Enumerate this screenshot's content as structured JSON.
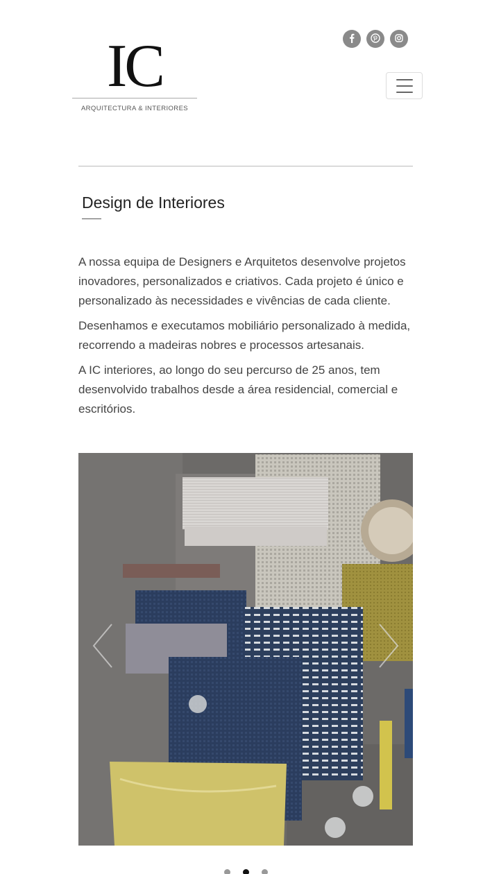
{
  "brand": {
    "logo_mark": "IC",
    "logo_sub": "ARQUITECTURA & INTERIORES"
  },
  "social": [
    {
      "name": "facebook-icon",
      "glyph": "f"
    },
    {
      "name": "pinterest-icon",
      "glyph": "p"
    },
    {
      "name": "instagram-icon",
      "glyph": "ig"
    }
  ],
  "page": {
    "title": "Design de Interiores",
    "paragraphs": [
      "A nossa equipa de Designers e Arquitetos desenvolve projetos inovadores, personalizados e criativos. Cada projeto é único e personalizado às necessidades e vivências de cada cliente.",
      "Desenhamos e executamos mobiliário personalizado à medida, recorrendo a madeiras nobres e processos artesanais.",
      "A IC interiores, ao longo do seu percurso de 25 anos, tem desenvolvido trabalhos desde a área residencial, comercial e escritórios."
    ]
  },
  "carousel": {
    "slide_count": 3,
    "active_index": 1
  },
  "colors": {
    "social_bg": "#8a8a8a",
    "text": "#444444",
    "title": "#222222"
  }
}
